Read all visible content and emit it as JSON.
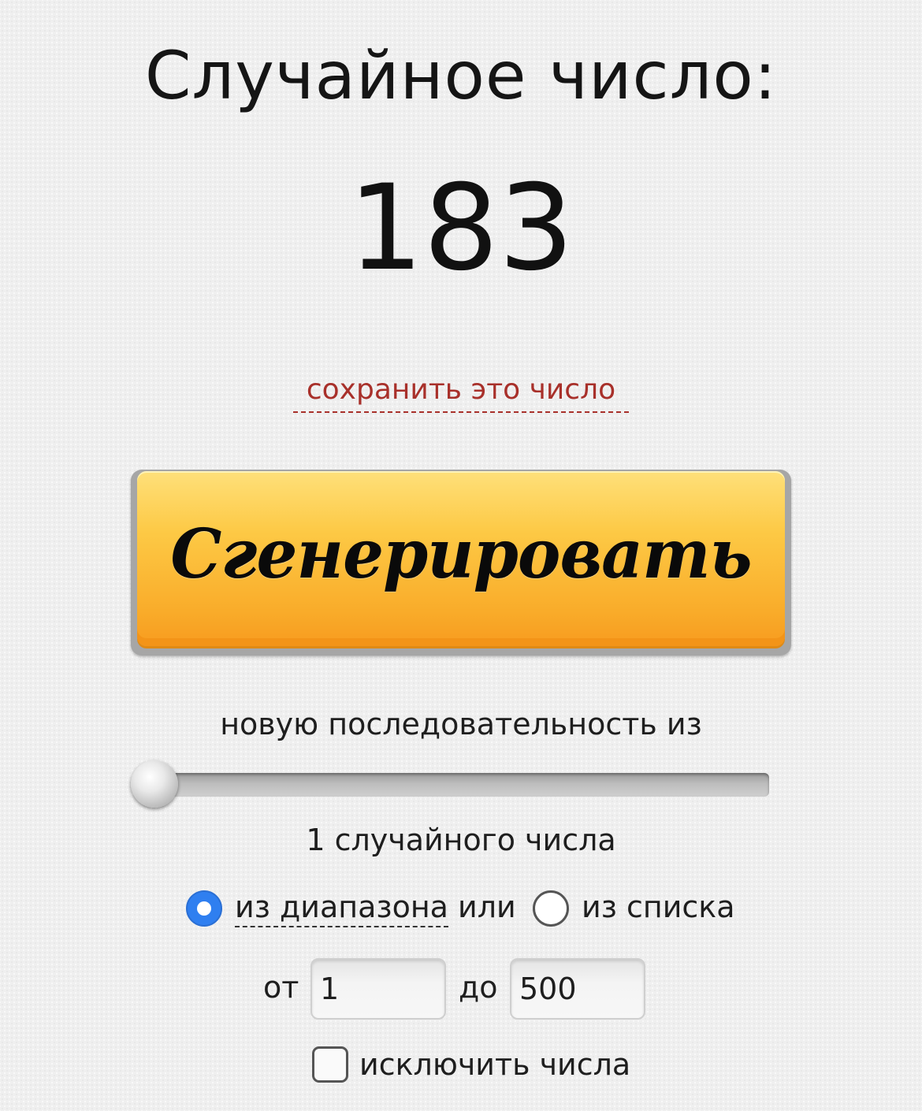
{
  "header": {
    "title": "Случайное число:",
    "result": "183"
  },
  "save": {
    "label": "сохранить это число"
  },
  "generate": {
    "label": "Сгенерировать"
  },
  "sequence": {
    "label": "новую последовательность из",
    "slider_level": 0.0,
    "count_label": "1 случайного числа"
  },
  "mode": {
    "selected": "range",
    "range_label": "из диапазона",
    "or_label": " или",
    "list_label": "из списка"
  },
  "range": {
    "from_label": "от",
    "from_value": "1",
    "to_label": "до",
    "to_value": "500"
  },
  "exclude": {
    "checked": false,
    "label": "исключить числа"
  },
  "colors": {
    "background": "#efefef",
    "link": "#a8302a",
    "button_top": "#fee07a",
    "button_bottom": "#f79b1f",
    "radio_selected": "#2f7ff0"
  }
}
